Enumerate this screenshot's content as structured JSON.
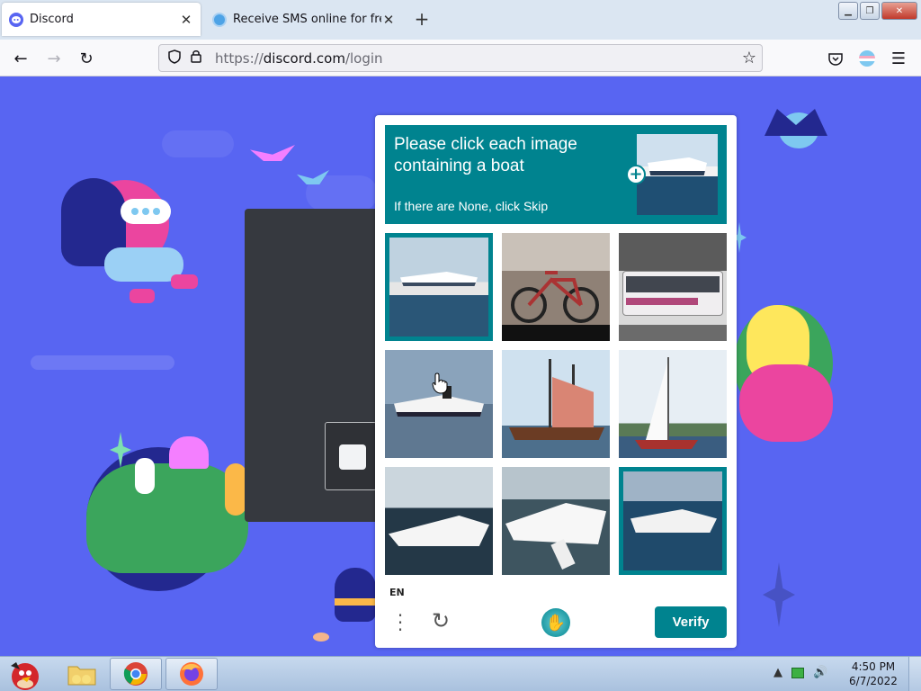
{
  "browser": {
    "tabs": [
      {
        "title": "Discord",
        "icon": "discord-icon",
        "active": true
      },
      {
        "title": "Receive SMS online for free |",
        "icon": "sms-site-icon",
        "active": false
      }
    ],
    "url_scheme": "https://",
    "url_domain": "discord.com",
    "url_path": "/login"
  },
  "captcha": {
    "prompt_line1": "Please click each image",
    "prompt_line2": "containing a boat",
    "prompt_hint": "If there are None, click Skip",
    "language": "EN",
    "verify_label": "Verify",
    "accent_color": "#00838f",
    "tiles": [
      {
        "subject": "cruise ship",
        "selected": true
      },
      {
        "subject": "bicycle",
        "selected": false
      },
      {
        "subject": "bus",
        "selected": false
      },
      {
        "subject": "cruise ship",
        "selected": false
      },
      {
        "subject": "tall ship",
        "selected": false
      },
      {
        "subject": "sailboat",
        "selected": false
      },
      {
        "subject": "motorboat",
        "selected": false
      },
      {
        "subject": "motorboat",
        "selected": false
      },
      {
        "subject": "motorboat",
        "selected": true
      }
    ]
  },
  "taskbar": {
    "clock_time": "4:50 PM",
    "clock_date": "6/7/2022",
    "apps": [
      "angry-birds-icon",
      "folder-icon",
      "chrome-icon",
      "firefox-icon"
    ]
  },
  "colors": {
    "page_background": "#5865f2",
    "dark_panel": "#36393f"
  }
}
